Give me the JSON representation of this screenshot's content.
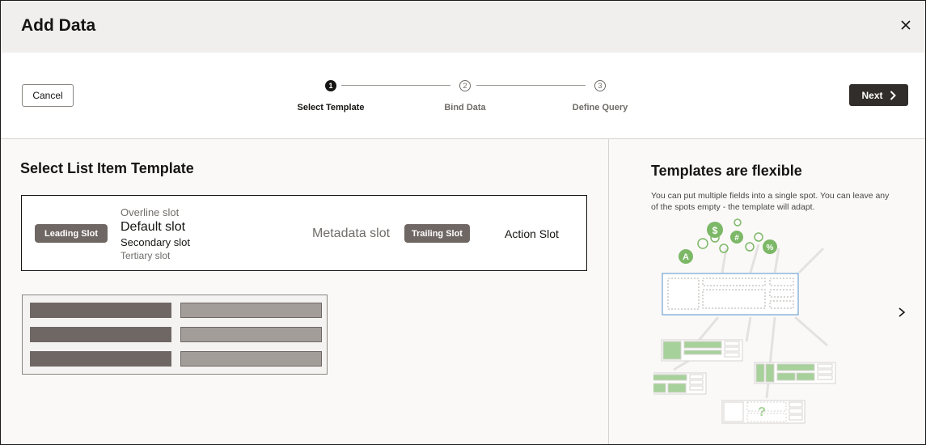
{
  "dialog": {
    "title": "Add Data",
    "close_icon": "close-icon"
  },
  "toolbar": {
    "cancel_label": "Cancel",
    "next_label": "Next",
    "next_icon": "chevron-right-icon"
  },
  "steps": [
    {
      "number": "1",
      "label": "Select Template",
      "state": "active"
    },
    {
      "number": "2",
      "label": "Bind Data",
      "state": "todo"
    },
    {
      "number": "3",
      "label": "Define Query",
      "state": "todo"
    }
  ],
  "left": {
    "section_title": "Select List Item Template",
    "template": {
      "leading_slot": "Leading Slot",
      "overline_slot": "Overline slot",
      "default_slot": "Default slot",
      "secondary_slot": "Secondary slot",
      "tertiary_slot": "Tertiary slot",
      "metadata_slot": "Metadata slot",
      "trailing_slot": "Trailing Slot",
      "action_slot": "Action Slot"
    }
  },
  "right": {
    "title": "Templates are flexible",
    "description": "You can put multiple fields into a single spot. You can leave any of the spots empty - the template will adapt.",
    "illustration_symbols": [
      "A",
      "$",
      "#",
      "%",
      "?"
    ],
    "next_icon": "chevron-right-icon"
  },
  "colors": {
    "accent_dark": "#312d2a",
    "badge": "#6f6764",
    "illustration_green": "#7cb867"
  }
}
